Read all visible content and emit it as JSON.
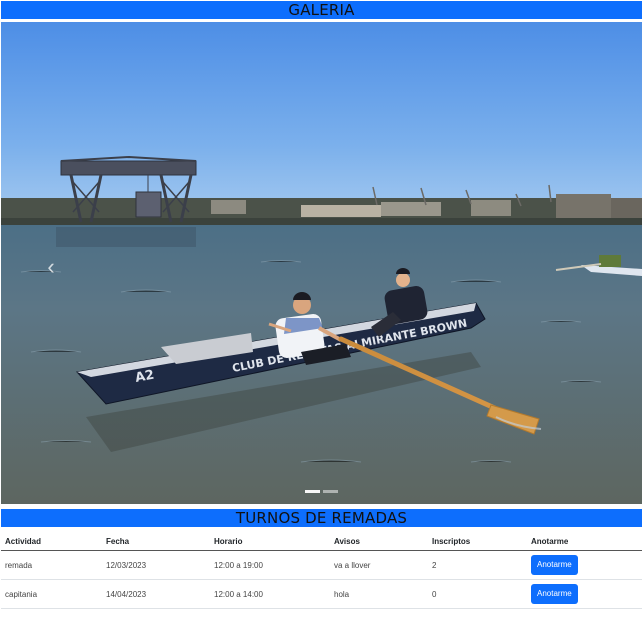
{
  "gallery": {
    "title": "GALERIA",
    "prev_icon": "‹",
    "next_icon": "›",
    "image_alt": "rowing-boat-photo",
    "boat_name": "CLUB DE REGATAS ALMIRANTE BROWN",
    "boat_number": "A2",
    "indicators": [
      "slide-1",
      "slide-2"
    ],
    "active_indicator": 0
  },
  "turnos": {
    "title": "TURNOS DE REMADAS",
    "headers": [
      "Actividad",
      "Fecha",
      "Horario",
      "Avisos",
      "Inscriptos",
      "Anotarme"
    ],
    "rows": [
      {
        "actividad": "remada",
        "fecha": "12/03/2023",
        "horario": "12:00 a 19:00",
        "avisos": "va a llover",
        "inscriptos": "2",
        "button": "Anotarme"
      },
      {
        "actividad": "capitania",
        "fecha": "14/04/2023",
        "horario": "12:00 a 14:00",
        "avisos": "hola",
        "inscriptos": "0",
        "button": "Anotarme"
      }
    ]
  },
  "colors": {
    "header_bar": "#0d6efd",
    "button": "#0d6efd"
  }
}
